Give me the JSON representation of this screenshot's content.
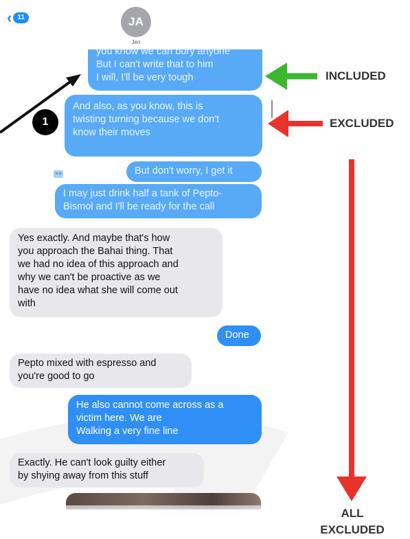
{
  "header": {
    "back_count": "11",
    "avatar_initials": "JA",
    "contact_name": "Jen"
  },
  "messages": {
    "m1": {
      "lines": [
        "you know we can bury anyone",
        "But I can't write that to him",
        "I will, I'll be very tough"
      ]
    },
    "m2": {
      "lines": [
        "And also, as you know, this is",
        "twisting turning because we don't",
        "know their moves"
      ]
    },
    "m3": {
      "lines": [
        "But don't worry, I get it"
      ]
    },
    "m4": {
      "lines": [
        "I may just drink half a tank of Pepto-",
        "Bismol and I'll be ready for the call"
      ]
    },
    "m5": {
      "lines": [
        "Yes exactly. And maybe that's how",
        "you approach the Bahai thing. That",
        "we had no idea of this approach and",
        "why we can't be proactive as we",
        "have no idea what she will come out",
        "with"
      ]
    },
    "m6": {
      "lines": [
        "Done"
      ]
    },
    "m7": {
      "lines": [
        "Pepto mixed with espresso and",
        "you're good to go"
      ]
    },
    "m8": {
      "lines": [
        "He also cannot come across as a",
        "victim here. We are",
        "Walking a very fine line"
      ]
    },
    "m9": {
      "lines": [
        "Exactly. He can't look guilty either",
        "by shying away from this stuff"
      ]
    }
  },
  "annotations": {
    "badge_number": "1",
    "included_label": "INCLUDED",
    "excluded_label": "EXCLUDED",
    "all_label": "ALL",
    "all_excluded_label": "EXCLUDED",
    "colors": {
      "green": "#3cb830",
      "red": "#e8322c",
      "black": "#111111"
    }
  }
}
